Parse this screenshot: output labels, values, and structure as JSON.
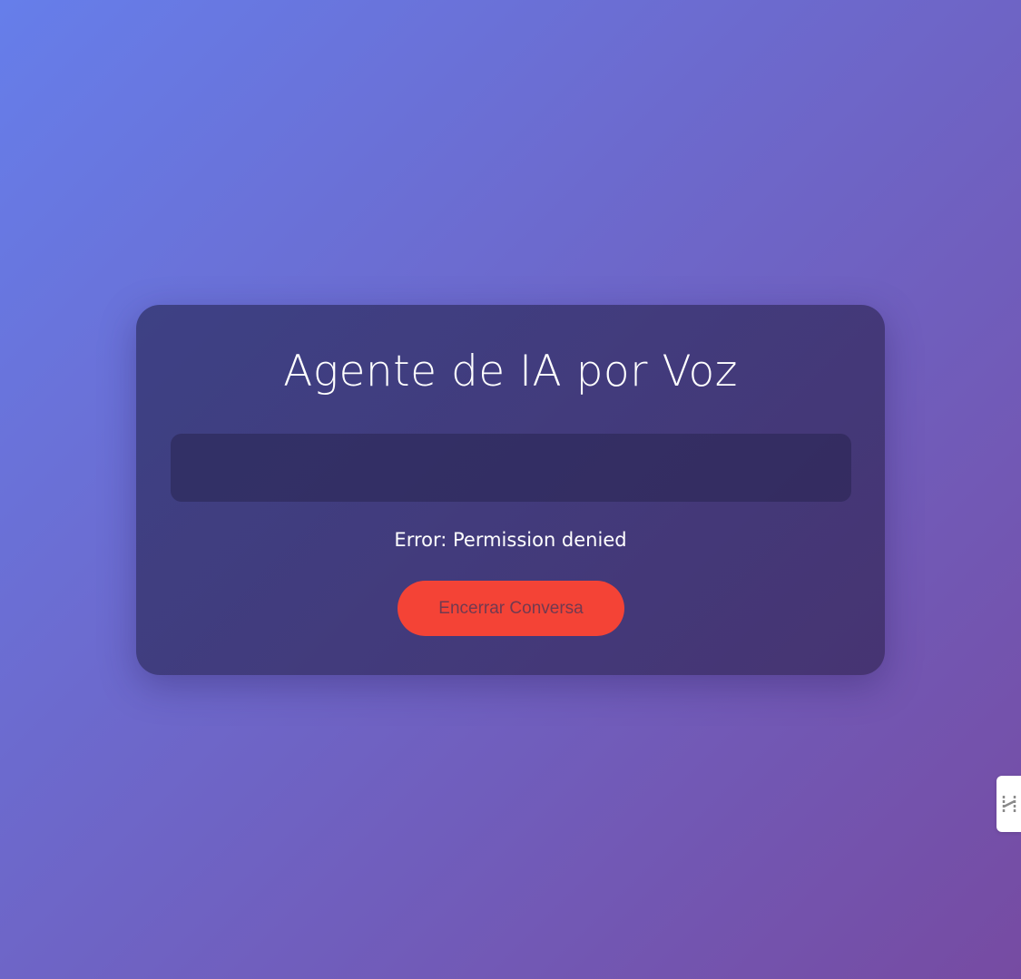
{
  "app": {
    "title": "Agente de IA por Voz"
  },
  "transcript": {
    "text": ""
  },
  "status": {
    "text": "Error: Permission denied"
  },
  "actions": {
    "end_label": "Encerrar Conversa"
  },
  "side_widget": {
    "icon": "hubspot-h-icon"
  },
  "colors": {
    "gradient_start": "#667eea",
    "gradient_end": "#764ba2",
    "end_button": "#f44336",
    "title_text": "#ffffff"
  }
}
